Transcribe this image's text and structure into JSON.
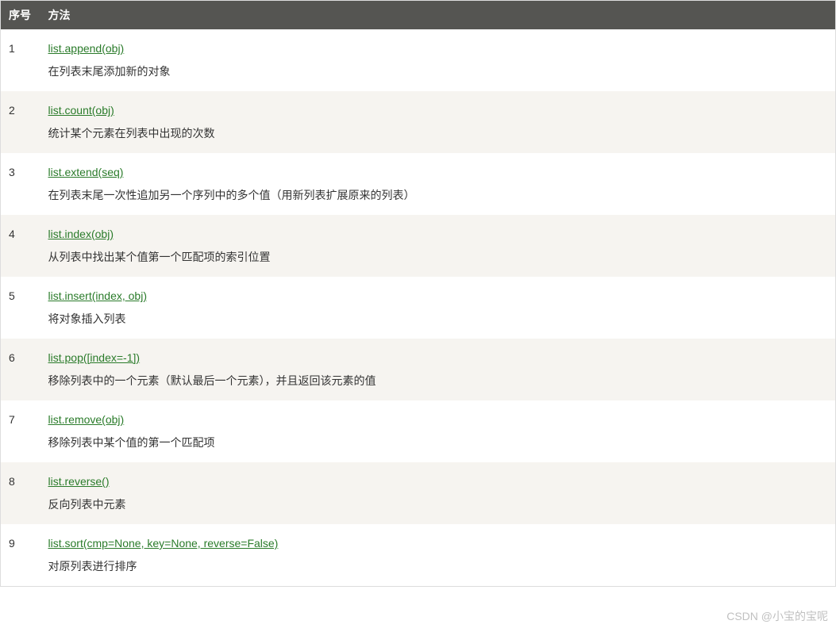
{
  "table": {
    "headers": {
      "col1": "序号",
      "col2": "方法"
    },
    "rows": [
      {
        "num": "1",
        "method": "list.append(obj)",
        "desc": "在列表末尾添加新的对象"
      },
      {
        "num": "2",
        "method": "list.count(obj)",
        "desc": "统计某个元素在列表中出现的次数"
      },
      {
        "num": "3",
        "method": "list.extend(seq)",
        "desc": "在列表末尾一次性追加另一个序列中的多个值（用新列表扩展原来的列表）"
      },
      {
        "num": "4",
        "method": "list.index(obj)",
        "desc": "从列表中找出某个值第一个匹配项的索引位置"
      },
      {
        "num": "5",
        "method": "list.insert(index, obj)",
        "desc": "将对象插入列表"
      },
      {
        "num": "6",
        "method": "list.pop([index=-1])",
        "desc": "移除列表中的一个元素（默认最后一个元素），并且返回该元素的值"
      },
      {
        "num": "7",
        "method": "list.remove(obj)",
        "desc": "移除列表中某个值的第一个匹配项"
      },
      {
        "num": "8",
        "method": "list.reverse()",
        "desc": "反向列表中元素"
      },
      {
        "num": "9",
        "method": "list.sort(cmp=None, key=None, reverse=False)",
        "desc": "对原列表进行排序"
      }
    ]
  },
  "watermark": "CSDN @小宝的宝呢"
}
